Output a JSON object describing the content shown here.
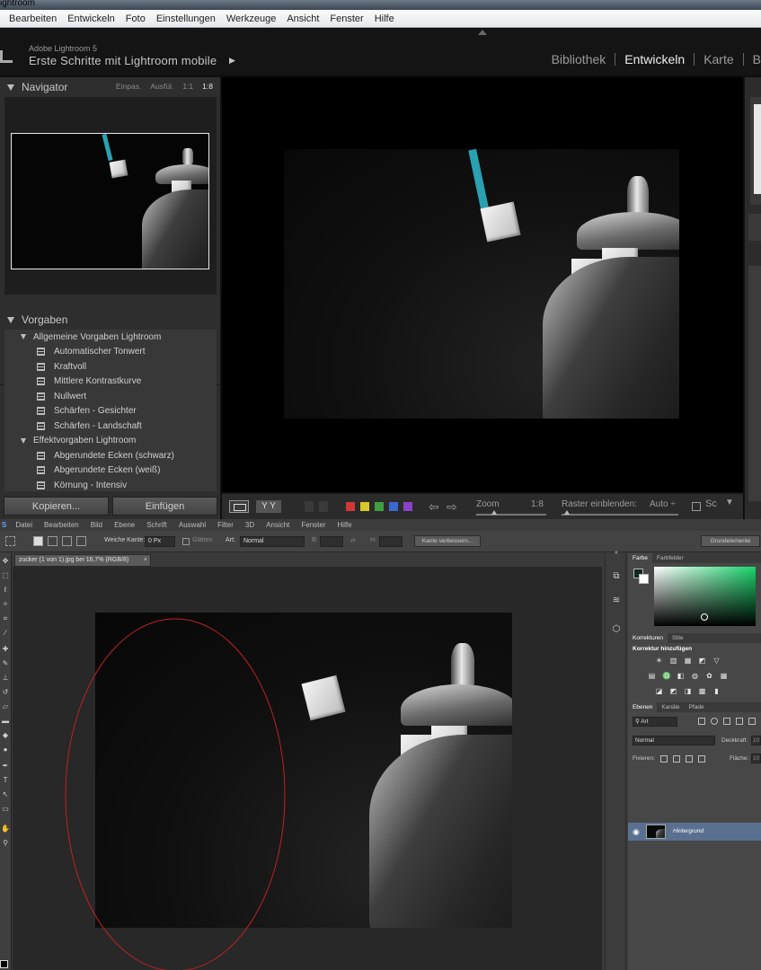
{
  "lightroom": {
    "window_title": "ightroom",
    "menu": [
      "Bearbeiten",
      "Entwickeln",
      "Foto",
      "Einstellungen",
      "Werkzeuge",
      "Ansicht",
      "Fenster",
      "Hilfe"
    ],
    "app_name": "Adobe Lightroom 5",
    "catalog_title": "Erste Schritte mit Lightroom mobile",
    "modules": [
      "Bibliothek",
      "Entwickeln",
      "Karte",
      "B"
    ],
    "active_module": "Entwickeln",
    "navigator": {
      "title": "Navigator",
      "zoom_options": [
        "Einpas.",
        "Ausfül.",
        "1:1",
        "1:8"
      ],
      "active_zoom": "1:8"
    },
    "presets": {
      "title": "Vorgaben",
      "groups": [
        {
          "name": "Allgemeine Vorgaben Lightroom",
          "items": [
            "Automatischer Tonwert",
            "Kraftvoll",
            "Mittlere Kontrastkurve",
            "Nullwert",
            "Schärfen - Gesichter",
            "Schärfen - Landschaft"
          ]
        },
        {
          "name": "Effektvorgaben Lightroom",
          "items": [
            "Abgerundete Ecken (schwarz)",
            "Abgerundete Ecken (weiß)",
            "Körnung - Intensiv"
          ]
        }
      ]
    },
    "buttons": {
      "copy": "Kopieren...",
      "paste": "Einfügen"
    },
    "toolbar": {
      "yy": "Y Y",
      "zoom_label": "Zoom",
      "zoom_value": "1:8",
      "grid_label": "Raster einblenden:",
      "grid_value": "Auto ÷",
      "sc_label": "Sc",
      "color_labels": [
        "#d03838",
        "#d8c828",
        "#40a040",
        "#3a6ad0",
        "#8a40c8"
      ]
    }
  },
  "photoshop": {
    "menu": [
      "Datei",
      "Bearbeiten",
      "Bild",
      "Ebene",
      "Schrift",
      "Auswahl",
      "Filter",
      "3D",
      "Ansicht",
      "Fenster",
      "Hilfe"
    ],
    "options": {
      "feather_label": "Weiche Kante:",
      "feather_value": "0 Px",
      "antialias_label": "Glätten",
      "style_label": "Art:",
      "style_value": "Normal",
      "width_label": "B:",
      "height_label": "H:",
      "refine_edge": "Kante verbessern...",
      "workspace": "Grundelemente"
    },
    "document_tab": "zucker (1 von 1).jpg bei 16,7% (RGB/8)",
    "color_panel": {
      "tabs": [
        "Farbe",
        "Farbfelder"
      ],
      "foreground": "#0c2c23",
      "background": "#ffffff",
      "hue": "#19d36a"
    },
    "adjustments_panel": {
      "tabs": [
        "Korrekturen",
        "Stile"
      ],
      "title": "Korrektur hinzufügen"
    },
    "layers_panel": {
      "tabs": [
        "Ebenen",
        "Kanäle",
        "Pfade"
      ],
      "filter_value": "Art",
      "blend_mode": "Normal",
      "opacity_label": "Deckkraft:",
      "opacity_value": "10",
      "lock_label": "Fixieren:",
      "fill_label": "Fläche:",
      "fill_value": "10",
      "layers": [
        {
          "name": "Hintergrund",
          "visible": true
        }
      ]
    }
  }
}
